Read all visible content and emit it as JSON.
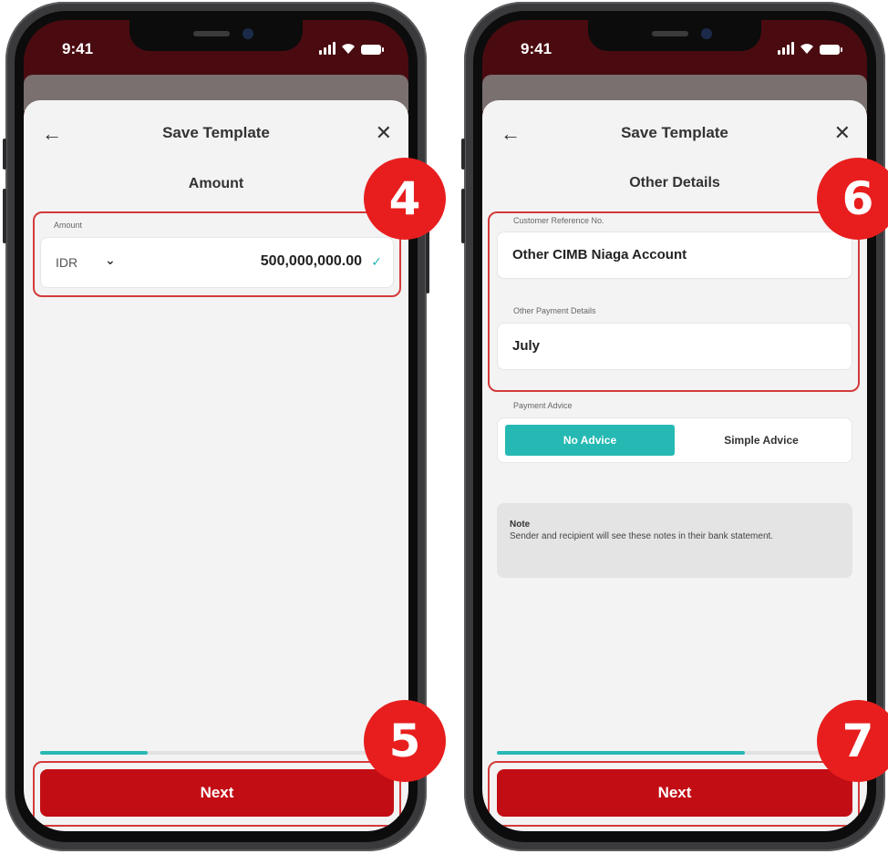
{
  "status_bar": {
    "time": "9:41"
  },
  "left_screen": {
    "header": {
      "title": "Save Template",
      "back_icon": "arrow-left-icon",
      "close_icon": "close-icon"
    },
    "section_title": "Amount",
    "amount_field": {
      "label": "Amount",
      "currency": "IDR",
      "value": "500,000,000.00"
    },
    "progress": 0.33,
    "next_label": "Next",
    "badges": {
      "top": "4",
      "bottom": "5"
    }
  },
  "right_screen": {
    "header": {
      "title": "Save Template",
      "back_icon": "arrow-left-icon",
      "close_icon": "close-icon"
    },
    "section_title": "Other Details",
    "customer_reference": {
      "label": "Customer Reference No.",
      "value": "Other CIMB Niaga Account"
    },
    "other_payment": {
      "label": "Other Payment Details",
      "value": "July"
    },
    "payment_advice": {
      "label": "Payment Advice",
      "options": [
        "No Advice",
        "Simple Advice"
      ],
      "selected": "No Advice"
    },
    "note": {
      "title": "Note",
      "body": "Sender and recipient will see these notes in their bank statement."
    },
    "progress": 0.7,
    "next_label": "Next",
    "badges": {
      "top": "6",
      "bottom": "7"
    }
  },
  "colors": {
    "primary": "#c20d14",
    "accent": "#26b9b3",
    "badge": "#e81e1e",
    "highlight": "#d33a3a"
  }
}
